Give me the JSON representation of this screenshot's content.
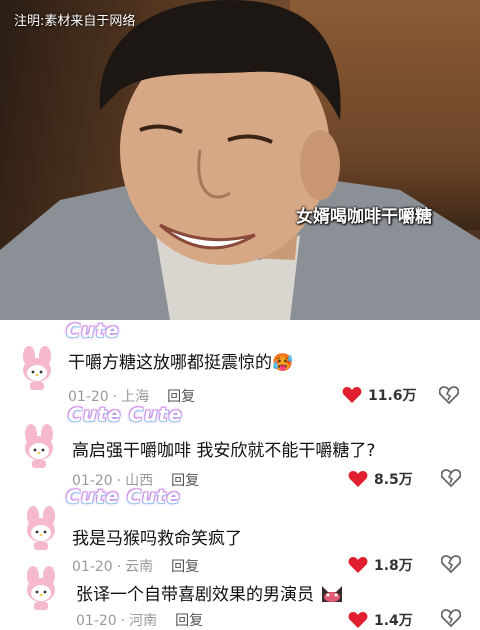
{
  "video": {
    "notice": "注明:素材来自于网络",
    "caption": "女婿喝咖啡干嚼糖"
  },
  "comments": [
    {
      "sticker": "Cute",
      "text": "干嚼方糖这放哪都挺震惊的",
      "emoji": "🥵",
      "date": "01-20",
      "location": "上海",
      "reply": "回复",
      "likes": "11.6万"
    },
    {
      "sticker": "Cute Cute",
      "text": "高启强干嚼咖啡 我安欣就不能干嚼糖了?",
      "date": "01-20",
      "location": "山西",
      "reply": "回复",
      "likes": "8.5万"
    },
    {
      "sticker": "Cute Cute",
      "text": "我是马猴吗救命笑疯了",
      "date": "01-20",
      "location": "云南",
      "reply": "回复",
      "likes": "1.8万"
    },
    {
      "sticker": "",
      "text": "张译一个自带喜剧效果的男演员",
      "date": "01-20",
      "location": "河南",
      "reply": "回复",
      "likes": "1.4万"
    }
  ],
  "colors": {
    "like_heart": "#e0202e",
    "accent_purple": "#c08ae6"
  },
  "icons": {
    "avatar": "my-melody-avatar-icon",
    "like": "heart-icon",
    "dislike": "broken-heart-icon"
  }
}
